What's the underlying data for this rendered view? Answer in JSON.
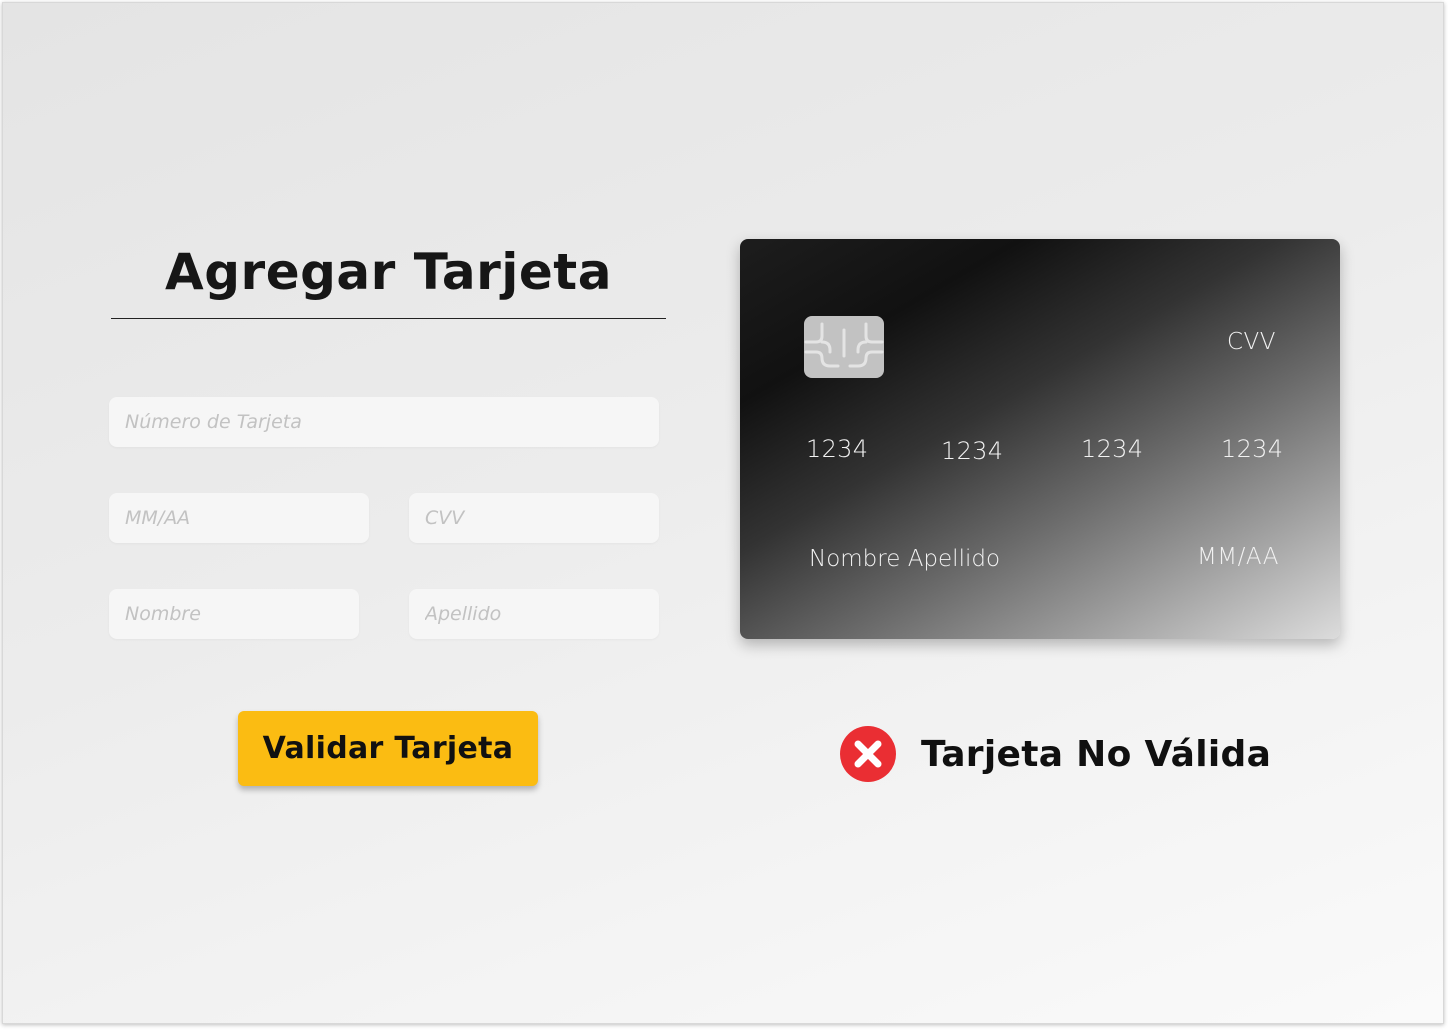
{
  "form": {
    "title": "Agregar Tarjeta",
    "card_number_placeholder": "Número de Tarjeta",
    "expiry_placeholder": "MM/AA",
    "cvv_placeholder": "CVV",
    "first_name_placeholder": "Nombre",
    "last_name_placeholder": "Apellido",
    "submit_label": "Validar Tarjeta",
    "submit_color": "#fbbc12"
  },
  "card_preview": {
    "chip_icon": "chip-icon",
    "cvv_label": "CVV",
    "number_groups": [
      "1234",
      "1234",
      "1234",
      "1234"
    ],
    "holder_name": "Nombre Apellido",
    "expiry": "MM/AA"
  },
  "status": {
    "icon": "x-circle-icon",
    "icon_color": "#ea2e33",
    "text": "Tarjeta No Válida"
  }
}
